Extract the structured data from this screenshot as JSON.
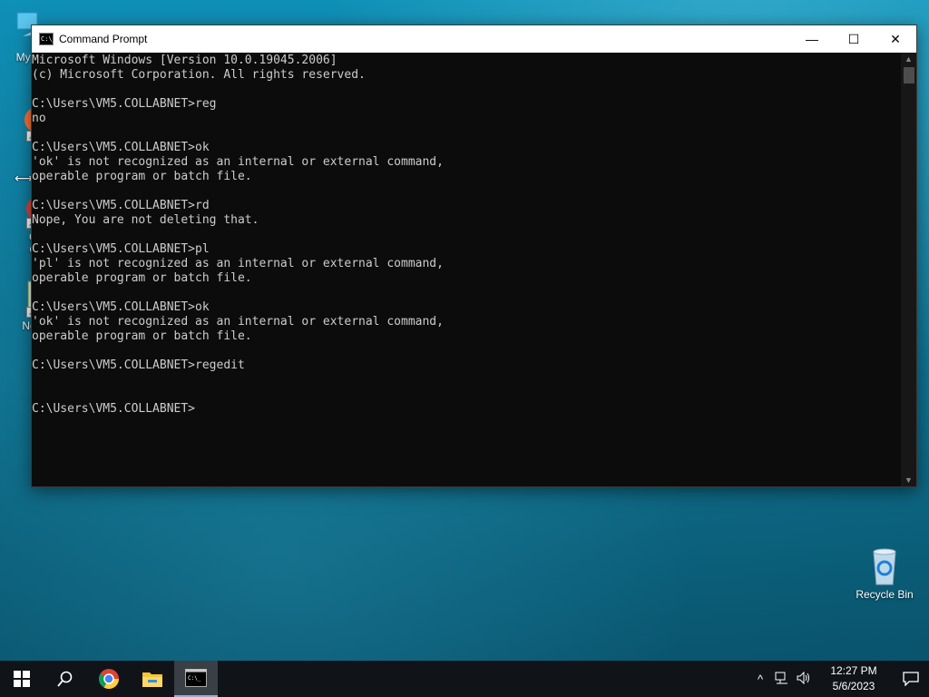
{
  "desktop": {
    "icons": [
      {
        "label": "My Co"
      },
      {
        "label": "Fi"
      },
      {
        "label": "Go"
      },
      {
        "label": "Ch"
      },
      {
        "label": "Note"
      },
      {
        "label": "Recycle Bin"
      }
    ]
  },
  "window": {
    "title": "Command Prompt",
    "title_icon_text": "C:\\_",
    "minimize": "—",
    "maximize": "☐",
    "close": "✕",
    "console_lines": [
      "Microsoft Windows [Version 10.0.19045.2006]",
      "(c) Microsoft Corporation. All rights reserved.",
      "",
      "C:\\Users\\VM5.COLLABNET>reg",
      "no",
      "",
      "C:\\Users\\VM5.COLLABNET>ok",
      "'ok' is not recognized as an internal or external command,",
      "operable program or batch file.",
      "",
      "C:\\Users\\VM5.COLLABNET>rd",
      "Nope, You are not deleting that.",
      "",
      "C:\\Users\\VM5.COLLABNET>pl",
      "'pl' is not recognized as an internal or external command,",
      "operable program or batch file.",
      "",
      "C:\\Users\\VM5.COLLABNET>ok",
      "'ok' is not recognized as an internal or external command,",
      "operable program or batch file.",
      "",
      "C:\\Users\\VM5.COLLABNET>regedit",
      "",
      "",
      "C:\\Users\\VM5.COLLABNET>"
    ]
  },
  "taskbar": {
    "start_icon": "windows-logo-icon",
    "clock_time": "12:27 PM",
    "clock_date": "5/6/2023",
    "tray_chevron": "^",
    "colors": {
      "accent": "#76b9ed",
      "bar": "#101419"
    }
  }
}
